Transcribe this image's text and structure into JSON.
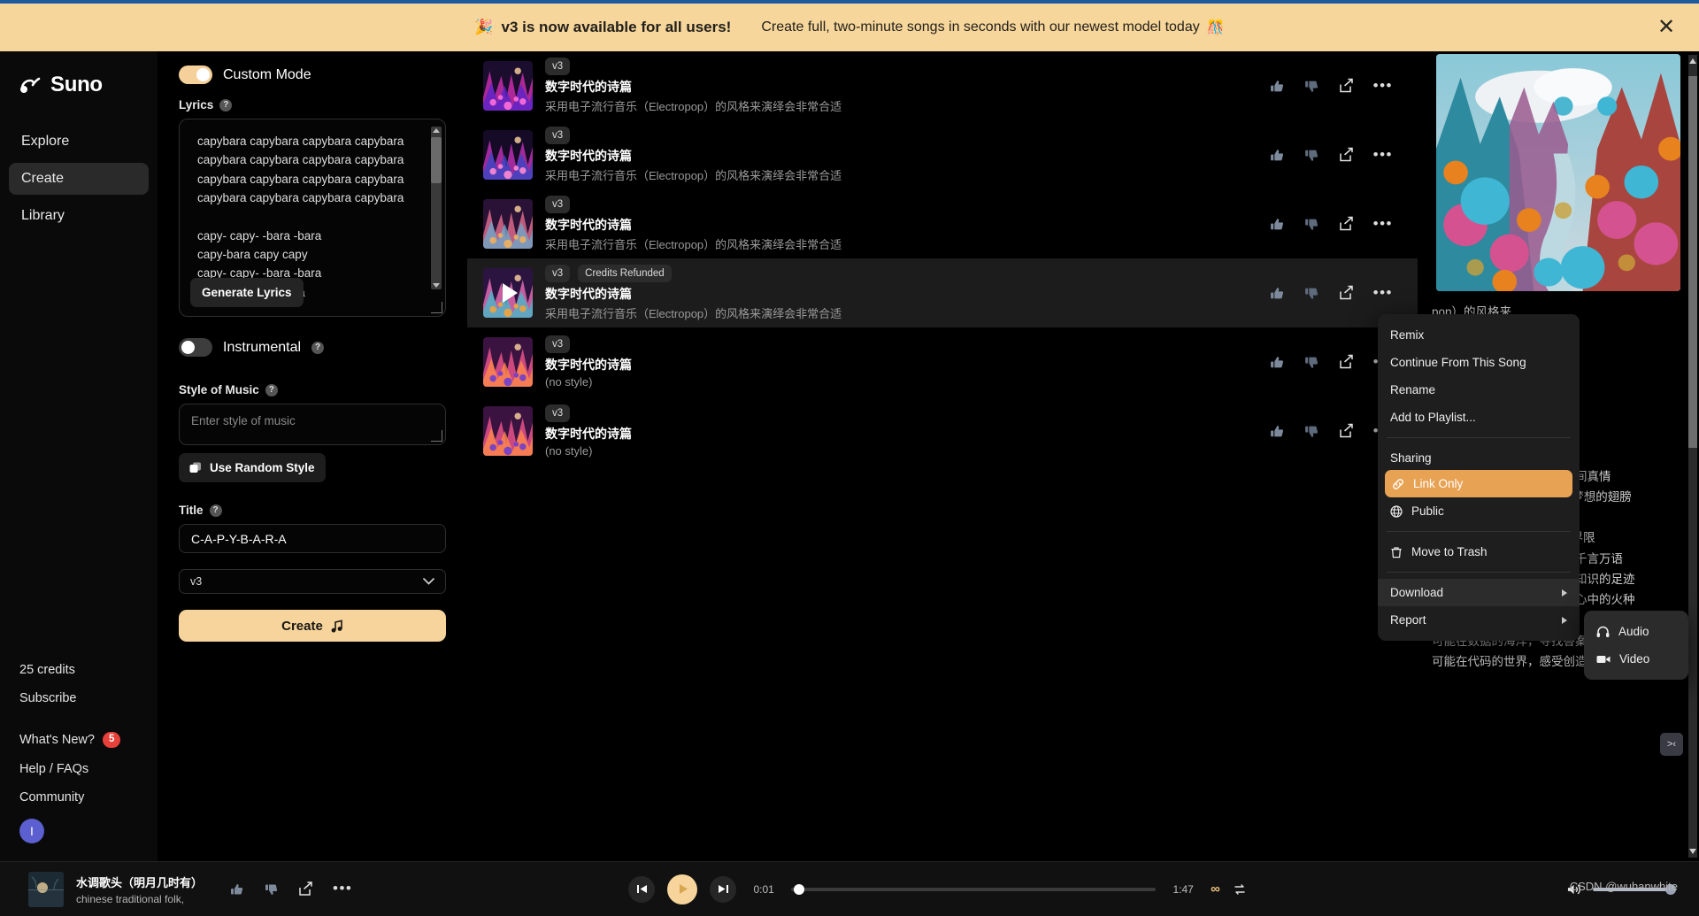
{
  "banner": {
    "headline": "v3 is now available for all users!",
    "subtext": "Create full, two-minute songs in seconds with our newest model today",
    "emoji_left": "🎉",
    "emoji_right": "🎊",
    "close_label": "✕"
  },
  "sidebar": {
    "brand": "Suno",
    "items": [
      {
        "label": "Explore",
        "active": false
      },
      {
        "label": "Create",
        "active": true
      },
      {
        "label": "Library",
        "active": false
      }
    ],
    "credits": "25 credits",
    "subscribe": "Subscribe",
    "whats_new": "What's New?",
    "whats_new_badge": "5",
    "help": "Help / FAQs",
    "community": "Community",
    "avatar_initial": "I"
  },
  "create": {
    "custom_mode_label": "Custom Mode",
    "custom_mode_on": true,
    "lyrics_label": "Lyrics",
    "lyrics_value": "capybara capybara capybara capybara\ncapybara capybara capybara capybara\ncapybara capybara capybara capybara\ncapybara capybara capybara capybara\n\ncapy- capy- -bara -bara\ncapy-bara capy capy\ncapy- capy- -bara -bara\ncapy-bara bara bara\n\nC-A-P-Y-B-A-R-A",
    "generate_lyrics_label": "Generate Lyrics",
    "instrumental_label": "Instrumental",
    "instrumental_on": false,
    "style_label": "Style of Music",
    "style_placeholder": "Enter style of music",
    "style_value": "",
    "random_style_label": "Use Random Style",
    "title_label": "Title",
    "title_value": "C-A-P-Y-B-A-R-A",
    "model_value": "v3",
    "create_label": "Create"
  },
  "songs": [
    {
      "version": "v3",
      "badge": "",
      "title": "数字时代的诗篇",
      "subtitle": "采用电子流行音乐（Electropop）的风格来演绎会非常合适",
      "selected": false,
      "playing": false,
      "cover": "c1"
    },
    {
      "version": "v3",
      "badge": "",
      "title": "数字时代的诗篇",
      "subtitle": "采用电子流行音乐（Electropop）的风格来演绎会非常合适",
      "selected": false,
      "playing": false,
      "cover": "c2"
    },
    {
      "version": "v3",
      "badge": "",
      "title": "数字时代的诗篇",
      "subtitle": "采用电子流行音乐（Electropop）的风格来演绎会非常合适",
      "selected": false,
      "playing": false,
      "cover": "c3"
    },
    {
      "version": "v3",
      "badge": "Credits Refunded",
      "title": "数字时代的诗篇",
      "subtitle": "采用电子流行音乐（Electropop）的风格来演绎会非常合适",
      "selected": true,
      "playing": true,
      "cover": "c4"
    },
    {
      "version": "v3",
      "badge": "",
      "title": "数字时代的诗篇",
      "subtitle": "(no style)",
      "selected": false,
      "playing": false,
      "cover": "c5"
    },
    {
      "version": "v3",
      "badge": "",
      "title": "数字时代的诗篇",
      "subtitle": "(no style)",
      "selected": false,
      "playing": false,
      "cover": "c6"
    }
  ],
  "row_icons": {
    "like": "thumbs-up-icon",
    "dislike": "thumbs-down-icon",
    "share": "share-icon",
    "more": "more-options-icon"
  },
  "context_menu": {
    "items": [
      {
        "label": "Remix",
        "type": "item"
      },
      {
        "label": "Continue From This Song",
        "type": "item"
      },
      {
        "label": "Rename",
        "type": "item"
      },
      {
        "label": "Add to Playlist...",
        "type": "item"
      },
      {
        "label": "Sharing",
        "type": "header"
      },
      {
        "label": "Link Only",
        "type": "item",
        "icon": "link-icon",
        "highlighted": true
      },
      {
        "label": "Public",
        "type": "item",
        "icon": "globe-icon"
      },
      {
        "label": "Move to Trash",
        "type": "item",
        "icon": "trash-icon"
      },
      {
        "label": "Download",
        "type": "submenu",
        "hovered": true
      },
      {
        "label": "Report",
        "type": "submenu"
      }
    ],
    "submenu": {
      "items": [
        {
          "label": "Audio",
          "icon": "headphones-icon"
        },
        {
          "label": "Video",
          "icon": "video-camera-icon"
        }
      ]
    }
  },
  "right_panel": {
    "lyrics_visible": "pop）的风格来\n\n\n宛皙谱清言的\n\n梦越语言的河\n亿走\n\n可能商量和百川，共话天地间真情\n可能MiniMax与讯飞，描绘梦想的翅膀\n\n可能360智脑探索，未知的界限\n可能通义千问解答，生活的千言万语\n可能子曰和序列猴子，留下知识的足迹\n可能面壁露卡与天工，启发心中的火种\n\n可能在数据的海洋，寻找答案的灵魂\n可能在代码的世界，感受创造的温度",
    "expand_icon": "expand-icon"
  },
  "player": {
    "title": "水调歌头（明月几时有）",
    "subtitle": "chinese traditional folk,",
    "current_time": "0:01",
    "total_time": "1:47",
    "progress_percent": 1,
    "volume_percent": 100,
    "prev_icon": "skip-previous-icon",
    "play_icon": "play-icon",
    "next_icon": "skip-next-icon",
    "loop_icon": "infinite-loop-icon",
    "repeat_icon": "repeat-icon",
    "volume_icon": "volume-icon",
    "watermark": "CSDN @wuhanwhite"
  },
  "colors": {
    "accent": "#f6d49c",
    "highlight": "#e8a254",
    "banner_bg": "#f6d69b",
    "badge_red": "#e8403a",
    "avatar": "#5b5fcf"
  }
}
